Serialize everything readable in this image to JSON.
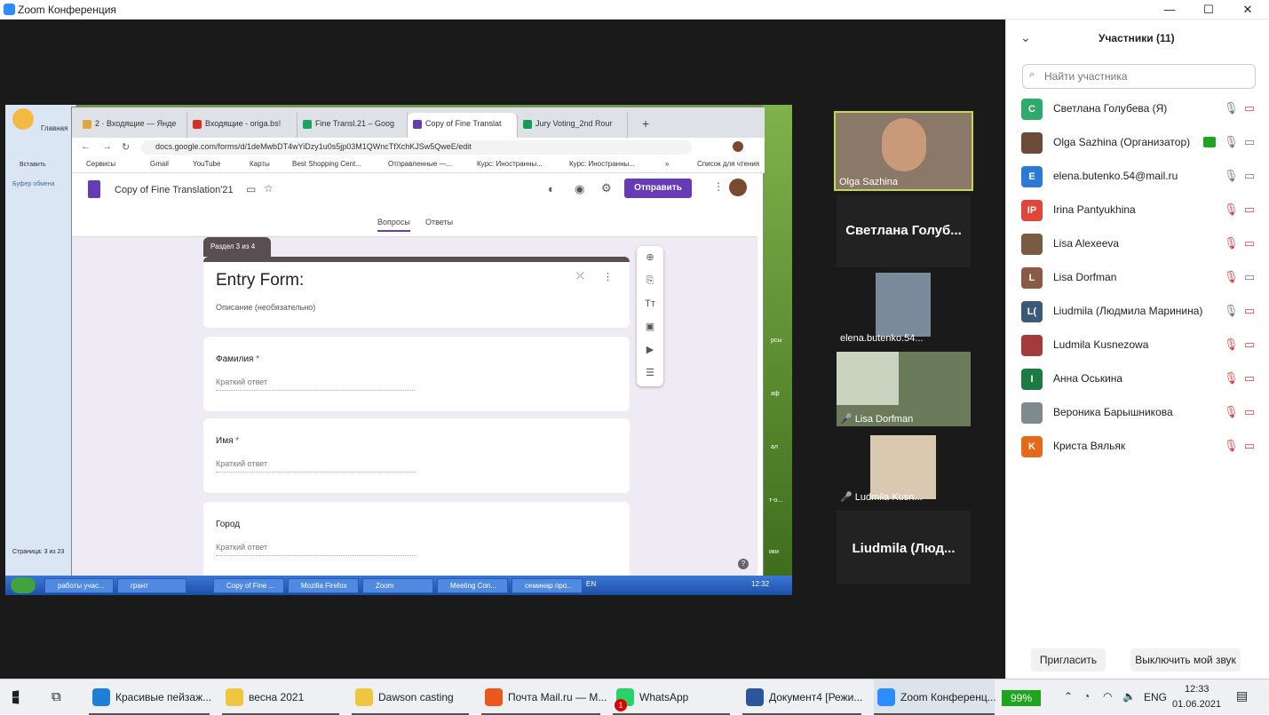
{
  "zoom": {
    "title": "Zoom Конференция",
    "min": "—",
    "max": "☐",
    "close": "✕"
  },
  "shared": {
    "word": {
      "tab": "Главная",
      "paste": "Вставить",
      "clipboard": "Буфер обмена",
      "status": "Страница: 3 из 23"
    },
    "desktop_labels": [
      "рсы",
      "аф",
      "ал",
      "т-о...",
      "ики"
    ],
    "tabs": [
      {
        "label": "2 · Входящие — Янде",
        "color": "#e0a73a",
        "close": "✕"
      },
      {
        "label": "Входящие - origa.bs!",
        "color": "#d93025",
        "close": "✕"
      },
      {
        "label": "Fine Transl.21 – Goog",
        "color": "#1aa260",
        "close": "✕"
      },
      {
        "label": "Copy of Fine Translat",
        "color": "#673ab7",
        "close": "✕"
      },
      {
        "label": "Jury Voting_2nd Rour",
        "color": "#0f9d58",
        "close": "✕"
      }
    ],
    "new_tab": "+",
    "url": "docs.google.com/forms/d/1deMwbDT4wYiDzy1u0s5jp03M1QWncTfXchKJSw5QweE/edit",
    "bookmarks": [
      "Сервисы",
      "Gmail",
      "YouTube",
      "Карты",
      "Best Shopping Cent...",
      "Отправленные —...",
      "Курс: Иностранны...",
      "Курс: Иностранны...",
      "»",
      "Список для чтения"
    ],
    "form": {
      "title": "Copy of Fine Translation'21",
      "send": "Отправить",
      "tab_questions": "Вопросы",
      "tab_answers": "Ответы",
      "section_badge": "Раздел 3 из 4",
      "section_title": "Entry Form:",
      "section_desc": "Описание (необязательно)",
      "questions": [
        {
          "label": "Фамилия",
          "required": "*",
          "placeholder": "Краткий ответ"
        },
        {
          "label": "Имя",
          "required": "*",
          "placeholder": "Краткий ответ"
        },
        {
          "label": "Город",
          "required": "",
          "placeholder": "Краткий ответ"
        }
      ],
      "help": "?"
    },
    "xp_taskbar": {
      "items": [
        "работы учас...",
        "грант",
        "Copy of Fine ...",
        "Mozilla Firefox",
        "Zoom",
        "Meeting Con...",
        "семинар про..."
      ],
      "lang": "EN",
      "time": "12:32"
    }
  },
  "videos": [
    {
      "name": "Olga Sazhina"
    },
    {
      "name": "Светлана  Голуб..."
    },
    {
      "name": "elena.butenko.54..."
    },
    {
      "name": "Lisa Dorfman"
    },
    {
      "name": "Ludmila Kusn..."
    },
    {
      "name": "Liudmila  (Люд..."
    }
  ],
  "panel": {
    "title": "Участники (11)",
    "collapse": "⌄",
    "search_placeholder": "Найти участника",
    "participants": [
      {
        "initials": "С",
        "color": "#2eaa6b",
        "name": "Светлана Голубева (Я)",
        "mic": "on",
        "cam": "off"
      },
      {
        "initials": "",
        "color": "#6b4a3a",
        "name": "Olga Sazhina (Организатор)",
        "mic": "on",
        "cam": "on",
        "share": true
      },
      {
        "initials": "E",
        "color": "#2b7bd6",
        "name": "elena.butenko.54@mail.ru",
        "mic": "on",
        "cam": "on"
      },
      {
        "initials": "IP",
        "color": "#e0463a",
        "name": "Irina Pantyukhina",
        "mic": "off",
        "cam": "off"
      },
      {
        "initials": "",
        "color": "#7a5a40",
        "name": "Lisa Alexeeva",
        "mic": "off",
        "cam": "off"
      },
      {
        "initials": "L",
        "color": "#8a5a46",
        "name": "Lisa Dorfman",
        "mic": "off",
        "cam": "on"
      },
      {
        "initials": "L(",
        "color": "#3a5a7a",
        "name": "Liudmila (Людмила Маринина)",
        "mic": "on",
        "cam": "off"
      },
      {
        "initials": "",
        "color": "#a33b3b",
        "name": "Ludmila Kusnezowa",
        "mic": "off",
        "cam": "off"
      },
      {
        "initials": "I",
        "color": "#1d7a43",
        "name": "Анна Оськина",
        "mic": "off",
        "cam": "off"
      },
      {
        "initials": "",
        "color": "#7f8a8f",
        "name": "Вероника Барышникова",
        "mic": "off",
        "cam": "off"
      },
      {
        "initials": "K",
        "color": "#e56a1a",
        "name": "Криста Вяльяк",
        "mic": "off",
        "cam": "off"
      }
    ],
    "invite": "Пригласить",
    "mute_me": "Выключить мой звук"
  },
  "taskbar": {
    "items": [
      {
        "label": "Красивые пейзаж...",
        "color": "#1f7fd8"
      },
      {
        "label": "весна 2021",
        "color": "#f0c640"
      },
      {
        "label": "Dawson casting",
        "color": "#f0c640"
      },
      {
        "label": "Почта Mail.ru — M...",
        "color": "#e8591a"
      },
      {
        "label": "WhatsApp",
        "color": "#25d366",
        "badge": "1"
      },
      {
        "label": "Документ4 [Режи...",
        "color": "#2b579a"
      },
      {
        "label": "Zoom Конференц...",
        "color": "#2d8cff"
      }
    ],
    "battery": "99%",
    "lang": "ENG",
    "time": "12:33",
    "date": "01.06.2021"
  }
}
